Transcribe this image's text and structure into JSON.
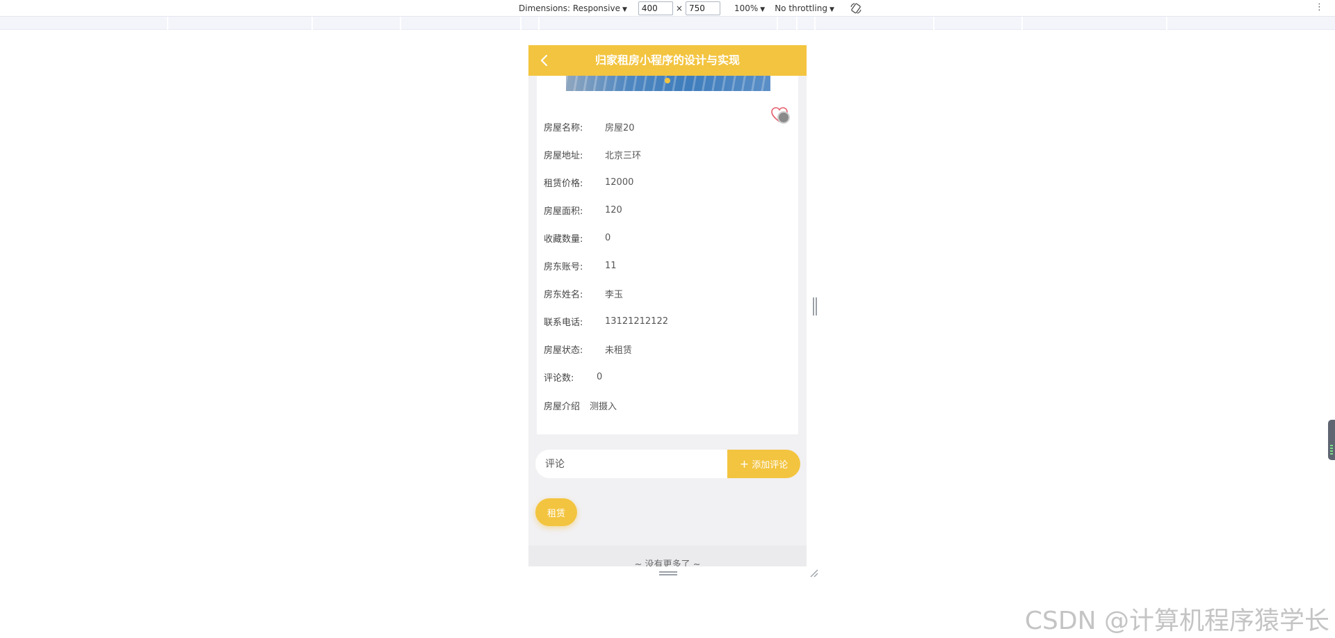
{
  "devtools": {
    "dimensions_label": "Dimensions: Responsive",
    "width_value": "400",
    "times": "×",
    "height_value": "750",
    "zoom": "100%",
    "throttling": "No throttling",
    "more_menu": "⋮"
  },
  "app": {
    "title": "归家租房小程序的设计与实现",
    "accent_color": "#f3c43f",
    "fields": [
      {
        "label": "房屋名称:",
        "value": "房屋20"
      },
      {
        "label": "房屋地址:",
        "value": "北京三环"
      },
      {
        "label": "租赁价格:",
        "value": "12000"
      },
      {
        "label": "房屋面积:",
        "value": "120"
      },
      {
        "label": "收藏数量:",
        "value": "0"
      },
      {
        "label": "房东账号:",
        "value": "11"
      },
      {
        "label": "房东姓名:",
        "value": "李玉"
      },
      {
        "label": "联系电话:",
        "value": "13121212122"
      },
      {
        "label": "房屋状态:",
        "value": "未租赁"
      },
      {
        "label": "评论数:",
        "value": "0"
      },
      {
        "label": "房屋介绍",
        "value": "测摄入"
      }
    ],
    "comment": {
      "placeholder": "评论",
      "add_button": "添加评论",
      "plus": "+"
    },
    "rent_button": "租赁",
    "no_more": "~ 没有更多了 ~"
  },
  "watermark": "CSDN @计算机程序猿学长"
}
